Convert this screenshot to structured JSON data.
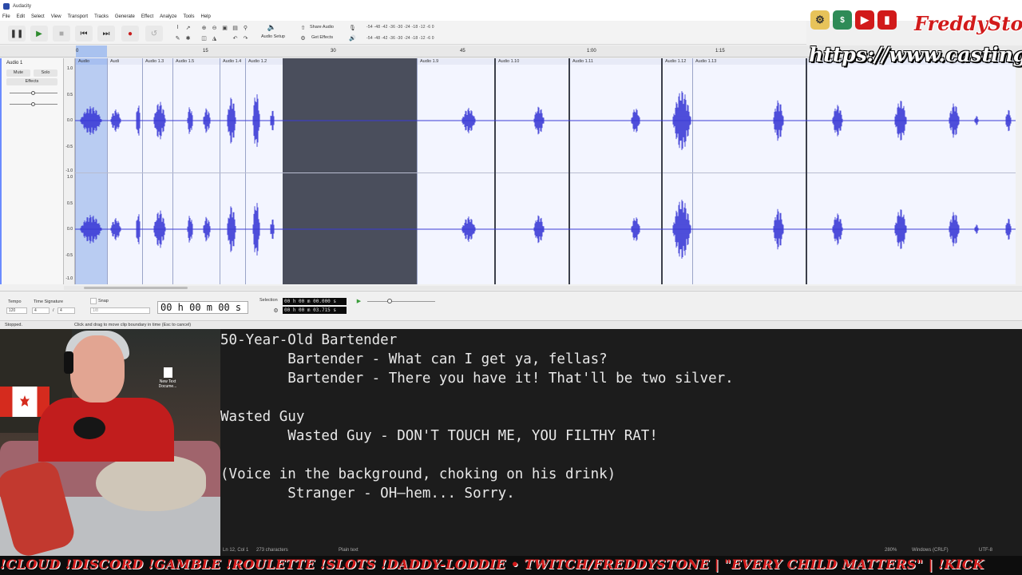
{
  "app": {
    "title": "Audacity"
  },
  "menu": [
    "File",
    "Edit",
    "Select",
    "View",
    "Transport",
    "Tracks",
    "Generate",
    "Effect",
    "Analyze",
    "Tools",
    "Help"
  ],
  "toolbar": {
    "audio_setup": "Audio Setup",
    "share_audio": "Share Audio",
    "get_effects": "Get Effects",
    "meter_scale": "-54 -48 -42 -36 -30 -24 -18 -12 -6 0",
    "play_meter_scale": "-54 -48 -42 -36 -30 -24 -18 -12 -6 0"
  },
  "ruler": {
    "ticks": [
      "0",
      "15",
      "30",
      "45",
      "1:00",
      "1:15"
    ]
  },
  "track": {
    "name": "Audio 1",
    "mute": "Mute",
    "solo": "Solo",
    "effects": "Effects",
    "vscale": [
      "1.0",
      "0.5",
      "0.0",
      "-0.5",
      "-1.0",
      "1.0",
      "0.5",
      "0.0",
      "-0.5",
      "-1.0"
    ]
  },
  "clips": [
    "Audio",
    "Audi",
    "Audio 1.3",
    "Audio 1.5",
    "Audio 1.4",
    "Audio 1.2",
    "Audio 1.9",
    "Audio 1.10",
    "Audio 1.11",
    "Audio 1.12",
    "Audio 1.13"
  ],
  "bottom": {
    "tempo_label": "Tempo",
    "tempo_value": "120",
    "time_sig_label": "Time Signature",
    "time_sig_num": "4",
    "time_sig_den": "4",
    "snap_label": "Snap",
    "snap_value": "1/8",
    "time_display": "00 h 00 m 00 s",
    "selection_label": "Selection",
    "selection_start": "00 h 00 m 00.000 s",
    "selection_end": "00 h 00 m 03.715 s"
  },
  "status": {
    "state": "Stopped.",
    "hint": "Click and drag to move clip boundary in time (Esc to cancel)"
  },
  "overlay": {
    "channel_name": "FreddyStone",
    "url": "https://www.castingca"
  },
  "desktop_icon": {
    "label": "New Text Docume..."
  },
  "editor": {
    "lines": [
      "50-Year-Old Bartender",
      "        Bartender - What can I get ya, fellas?",
      "        Bartender - There you have it! That'll be two silver.",
      "",
      "Wasted Guy",
      "        Wasted Guy - DON'T TOUCH ME, YOU FILTHY RAT!",
      "",
      "(Voice in the background, choking on his drink)",
      "        Stranger - OH—hem... Sorry."
    ],
    "status_pos": "Ln 12, Col 1",
    "status_chars": "273 characters",
    "status_mode": "Plain text",
    "status_zoom": "280%",
    "status_eol": "Windows (CRLF)",
    "status_enc": "UTF-8"
  },
  "ticker": {
    "text": "!CLOUD !DISCORD !GAMBLE !ROULETTE !SLOTS !DADDY-LODDIE • TWITCH/FREDDYSTONE | \"EVERY CHILD MATTERS\" | !KICK"
  },
  "colors": {
    "wave": "#3b3bd6",
    "selection": "#b9ccf2",
    "gap": "#4a4e5c",
    "accent_red": "#d11a1a"
  }
}
